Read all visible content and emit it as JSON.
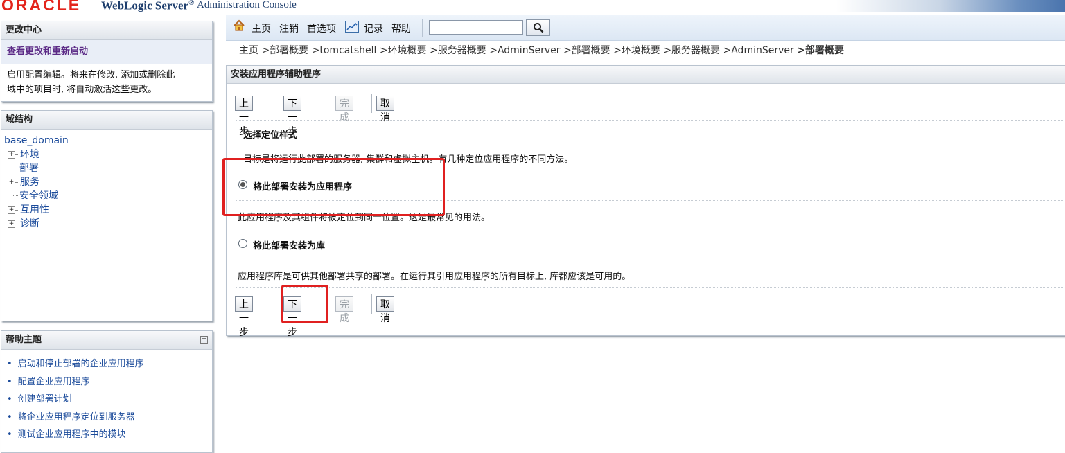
{
  "header": {
    "logo": "ORACLE",
    "product": "WebLogic Server",
    "product_mark": "®",
    "console": "Administration Console"
  },
  "change_center": {
    "title": "更改中心",
    "link": "查看更改和重新启动",
    "text_line1": "启用配置编辑。将来在修改, 添加或删除此",
    "text_line2": "域中的项目时, 将自动激活这些更改。"
  },
  "domain_structure": {
    "title": "域结构",
    "root": "base_domain",
    "items": [
      {
        "label": "环境",
        "expandable": true
      },
      {
        "label": "部署",
        "expandable": false
      },
      {
        "label": "服务",
        "expandable": true
      },
      {
        "label": "安全领域",
        "expandable": false
      },
      {
        "label": "互用性",
        "expandable": true
      },
      {
        "label": "诊断",
        "expandable": true
      }
    ]
  },
  "help": {
    "title": "帮助主题",
    "items": [
      "启动和停止部署的企业应用程序",
      "配置企业应用程序",
      "创建部署计划",
      "将企业应用程序定位到服务器",
      "测试企业应用程序中的模块"
    ]
  },
  "toolbar": {
    "home": "主页",
    "logout": "注销",
    "preferences": "首选项",
    "record": "记录",
    "help": "帮助",
    "search_value": ""
  },
  "breadcrumb": {
    "items": [
      "主页",
      ">部署概要",
      ">tomcatshell",
      ">环境概要",
      ">服务器概要",
      ">AdminServer",
      ">部署概要",
      ">环境概要",
      ">服务器概要",
      ">AdminServer"
    ],
    "current": ">部署概要"
  },
  "wizard": {
    "title": "安装应用程序辅助程序",
    "buttons": {
      "back": "上一步",
      "next": "下一步",
      "finish": "完成",
      "cancel": "取消"
    },
    "section_title": "选择定位样式",
    "description": "目标是将运行此部署的服务器, 集群和虚拟主机。有几种定位应用程序的不同方法。",
    "option_app": "将此部署安装为应用程序",
    "option_app_desc": "此应用程序及其组件将被定位到同一位置。这是最常见的用法。",
    "option_lib": "将此部署安装为库",
    "option_lib_desc": "应用程序库是可供其他部署共享的部署。在运行其引用应用程序的所有目标上, 库都应该是可用的。",
    "selected": "option_app"
  },
  "colors": {
    "annotation": "#e02020",
    "link": "#1a4a9a",
    "oracle_red": "#e3241b"
  }
}
